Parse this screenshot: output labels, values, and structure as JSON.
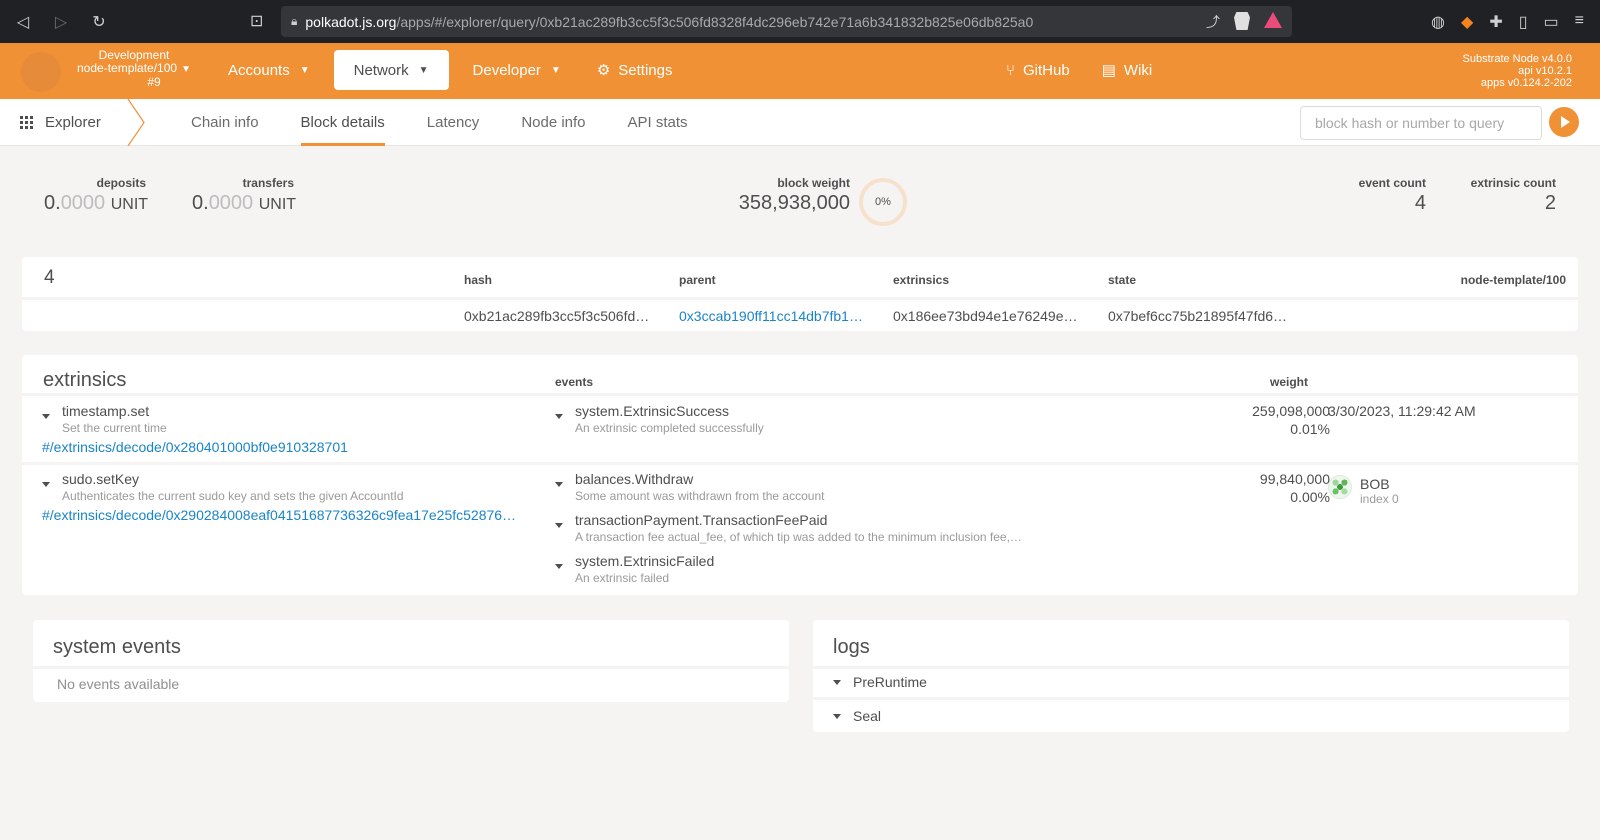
{
  "browser": {
    "url_domain": "polkadot.js.org",
    "url_rest": "/apps/#/explorer/query/0xb21ac289fb3cc5f3c506fd8328f4dc296eb742e71a6b341832b825e06db825a0"
  },
  "app_bar": {
    "chain": {
      "name": "Development",
      "node": "node-template/100",
      "block": "#9"
    },
    "menu": [
      {
        "label": "Accounts"
      },
      {
        "label": "Network"
      },
      {
        "label": "Developer"
      },
      {
        "label": "Settings"
      }
    ],
    "links": [
      {
        "label": "GitHub"
      },
      {
        "label": "Wiki"
      }
    ],
    "node_info": {
      "line1": "Substrate Node v4.0.0",
      "line2": "api v10.2.1",
      "line3": "apps v0.124.2-202"
    }
  },
  "sub_nav": {
    "explorer_label": "Explorer",
    "tabs": [
      {
        "label": "Chain info"
      },
      {
        "label": "Block details"
      },
      {
        "label": "Latency"
      },
      {
        "label": "Node info"
      },
      {
        "label": "API stats"
      }
    ],
    "query_placeholder": "block hash or number to query"
  },
  "summary": {
    "deposits": {
      "label": "deposits",
      "int": "0.",
      "dec": "0000",
      "unit": "UNIT"
    },
    "transfers": {
      "label": "transfers",
      "int": "0.",
      "dec": "0000",
      "unit": "UNIT"
    },
    "block_weight": {
      "label": "block weight",
      "value": "358,938,000",
      "percent": "0%"
    },
    "event_count": {
      "label": "event count",
      "value": "4"
    },
    "extrinsic_count": {
      "label": "extrinsic count",
      "value": "2"
    }
  },
  "block": {
    "number": "4",
    "headers": {
      "hash": "hash",
      "parent": "parent",
      "extrinsics": "extrinsics",
      "state": "state",
      "node": "node-template/100"
    },
    "hash": "0xb21ac289fb3cc5f3c506fd…",
    "parent": "0x3ccab190ff11cc14db7fb1…",
    "extrinsics_root": "0x186ee73bd94e1e76249e…",
    "state_root": "0x7bef6cc75b21895f47fd6e…"
  },
  "extrinsics": {
    "title": "extrinsics",
    "events_header": "events",
    "weight_header": "weight",
    "rows": [
      {
        "method": "timestamp.set",
        "desc": "Set the current time",
        "link": "#/extrinsics/decode/0x280401000bf0e910328701",
        "events": [
          {
            "name": "system.ExtrinsicSuccess",
            "desc": "An extrinsic completed successfully"
          }
        ],
        "weight": "259,098,000",
        "weight_pct": "0.01%",
        "time": "3/30/2023, 11:29:42 AM"
      },
      {
        "method": "sudo.setKey",
        "desc": "Authenticates the current sudo key and sets the given AccountId",
        "link": "#/extrinsics/decode/0x290284008eaf04151687736326c9fea17e25fc52876…",
        "events": [
          {
            "name": "balances.Withdraw",
            "desc": "Some amount was withdrawn from the account"
          },
          {
            "name": "transactionPayment.TransactionFeePaid",
            "desc": "A transaction fee actual_fee, of which tip was added to the minimum inclusion fee,…"
          },
          {
            "name": "system.ExtrinsicFailed",
            "desc": "An extrinsic failed"
          }
        ],
        "weight": "99,840,000",
        "weight_pct": "0.00%",
        "signer": {
          "name": "BOB",
          "index": "index 0"
        }
      }
    ]
  },
  "system_events": {
    "title": "system events",
    "empty": "No events available"
  },
  "logs": {
    "title": "logs",
    "items": [
      "PreRuntime",
      "Seal"
    ]
  },
  "colors": {
    "accent": "#f19135",
    "link": "#1a84c8",
    "bg": "#f5f4f3"
  }
}
